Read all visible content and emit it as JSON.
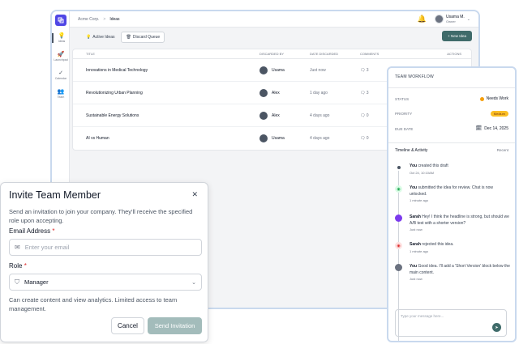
{
  "colors": {
    "accent": "#3f6b6a",
    "brand": "#4f46e5",
    "status_dot": "#f59e0b",
    "priority_badge": "#fbbf24"
  },
  "sidebar": {
    "items": [
      {
        "label": "Ideas",
        "icon": "lightbulb-icon"
      },
      {
        "label": "Launchpad",
        "icon": "rocket-icon"
      },
      {
        "label": "Calendar",
        "icon": "calendar-icon"
      },
      {
        "label": "Team",
        "icon": "team-icon"
      }
    ]
  },
  "topbar": {
    "breadcrumb_root": "Acme Corp.",
    "breadcrumb_sep": ">",
    "breadcrumb_current": "Ideas",
    "user_name": "Usama M.",
    "user_role": "Owner"
  },
  "tabs": {
    "active_label": "Active Ideas",
    "discard_label": "Discard Queue"
  },
  "new_button": "+ New Idea",
  "table": {
    "headers": [
      "TITLE",
      "DISCARDED BY",
      "DATE DISCARDED",
      "COMMENTS",
      "ACTIONS"
    ],
    "rows": [
      {
        "title": "Innovations in Medical Technology",
        "by": "Usama",
        "date": "Just now",
        "comments": "3"
      },
      {
        "title": "Revolutionizing Urban Planning",
        "by": "Alex",
        "date": "1 day ago",
        "comments": "3"
      },
      {
        "title": "Sustainable Energy Solutions",
        "by": "Alex",
        "date": "4 days ago",
        "comments": "0"
      },
      {
        "title": "AI vs Human",
        "by": "Usama",
        "date": "4 days ago",
        "comments": "0"
      }
    ]
  },
  "workflow": {
    "title": "TEAM WORKFLOW",
    "status_label": "STATUS",
    "status_value": "Needs Work",
    "priority_label": "PRIORITY",
    "priority_value": "Medium",
    "due_label": "DUE DATE",
    "due_value": "Dec 14, 2025",
    "timeline_title": "Timeline & Activity",
    "timeline_filter": "Recent",
    "timeline": [
      {
        "who": "You",
        "text": " created this draft",
        "time": "Oct 24, 10:10AM"
      },
      {
        "who": "You",
        "text": " submitted the idea for review. Chat is now unlocked.",
        "time": "1 minute ago"
      },
      {
        "who": "Sarah",
        "text": " Hey! I think the headline is strong, but should we A/B test with a shorter version?",
        "time": "Just now"
      },
      {
        "who": "Sarah",
        "text": " rejected this idea.",
        "time": "1 minute ago"
      },
      {
        "who": "You",
        "text": " Good idea. I'll add a 'Short Version' block below the main content.",
        "time": "Just now"
      }
    ],
    "message_placeholder": "Type your message here..."
  },
  "modal": {
    "title": "Invite Team Member",
    "description": "Send an invitation to join your company. They'll receive the specified role upon accepting.",
    "email_label": "Email Address",
    "email_required": "*",
    "email_placeholder": "Enter your email",
    "role_label": "Role",
    "role_required": "*",
    "role_value": "Manager",
    "role_hint": "Can create content and view analytics. Limited access to team management.",
    "cancel_label": "Cancel",
    "send_label": "Send Invitation"
  }
}
